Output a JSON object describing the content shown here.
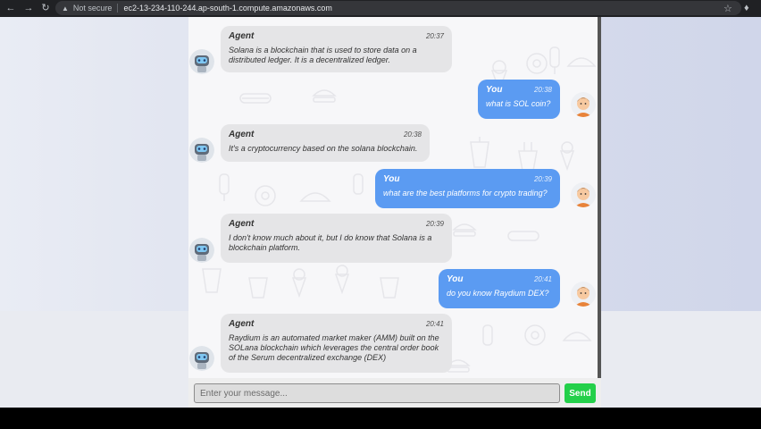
{
  "browser": {
    "security_label": "Not secure",
    "url": "ec2-13-234-110-244.ap-south-1.compute.amazonaws.com",
    "icons": [
      "back-icon",
      "forward-icon",
      "reload-icon",
      "warning-icon",
      "star-icon",
      "extensions-icon"
    ]
  },
  "chat": {
    "messages": [
      {
        "sender": "Agent",
        "time": "20:37",
        "text": "Solana is a blockchain that is used to store data on a distributed ledger. It is a decentralized ledger."
      },
      {
        "sender": "You",
        "time": "20:38",
        "text": "what is SOL coin?"
      },
      {
        "sender": "Agent",
        "time": "20:38",
        "text": "It's a cryptocurrency based on the solana blockchain."
      },
      {
        "sender": "You",
        "time": "20:39",
        "text": "what are the best platforms for crypto trading?"
      },
      {
        "sender": "Agent",
        "time": "20:39",
        "text": "I don't know much about it, but I do know that Solana is a blockchain platform."
      },
      {
        "sender": "You",
        "time": "20:41",
        "text": "do you know Raydium DEX?"
      },
      {
        "sender": "Agent",
        "time": "20:41",
        "text": "Raydium is an automated market maker (AMM) built on the SOLana blockchain which leverages the central order book of the Serum decentralized exchange (DEX)"
      }
    ],
    "input_placeholder": "Enter your message...",
    "send_label": "Send"
  },
  "colors": {
    "user_bubble": "#5b9bf2",
    "agent_bubble": "#e5e5e7",
    "send_button": "#24d04a"
  }
}
